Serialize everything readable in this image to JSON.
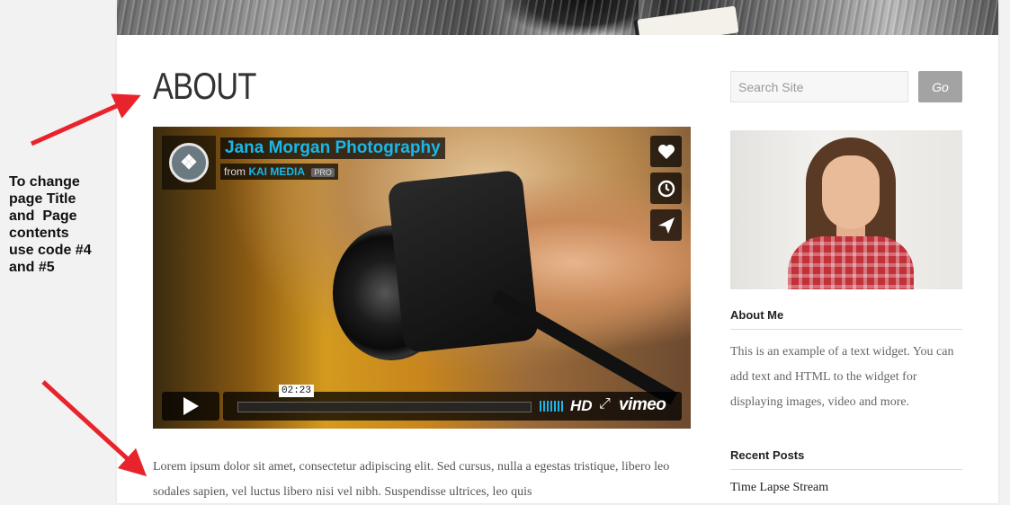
{
  "annotation": {
    "lines": [
      "To change",
      "page Title",
      "and  Page",
      "contents",
      "use code #4",
      "and #5"
    ]
  },
  "page": {
    "title": "ABOUT",
    "body_text": "Lorem ipsum dolor sit amet, consectetur adipiscing elit. Sed cursus, nulla a egestas tristique, libero leo sodales sapien, vel luctus libero nisi vel nibh. Suspendisse ultrices, leo quis"
  },
  "video": {
    "title": "Jana Morgan Photography",
    "from_label": "from",
    "author": "KAI MEDIA",
    "badge": "PRO",
    "timecode": "02:23",
    "hd_label": "HD",
    "brand": "vimeo",
    "side_buttons": [
      "heart-icon",
      "clock-icon",
      "send-icon"
    ]
  },
  "sidebar": {
    "search_placeholder": "Search Site",
    "go_label": "Go",
    "about_title": "About Me",
    "about_text": "This is an example of a text widget. You can add text and HTML to the widget for displaying images, video and more.",
    "recent_title": "Recent Posts",
    "recent_posts": [
      "Time Lapse Stream"
    ]
  },
  "colors": {
    "arrow": "#e8232c",
    "vimeo_blue": "#1ab7ea",
    "go_button": "#a3a3a3"
  }
}
